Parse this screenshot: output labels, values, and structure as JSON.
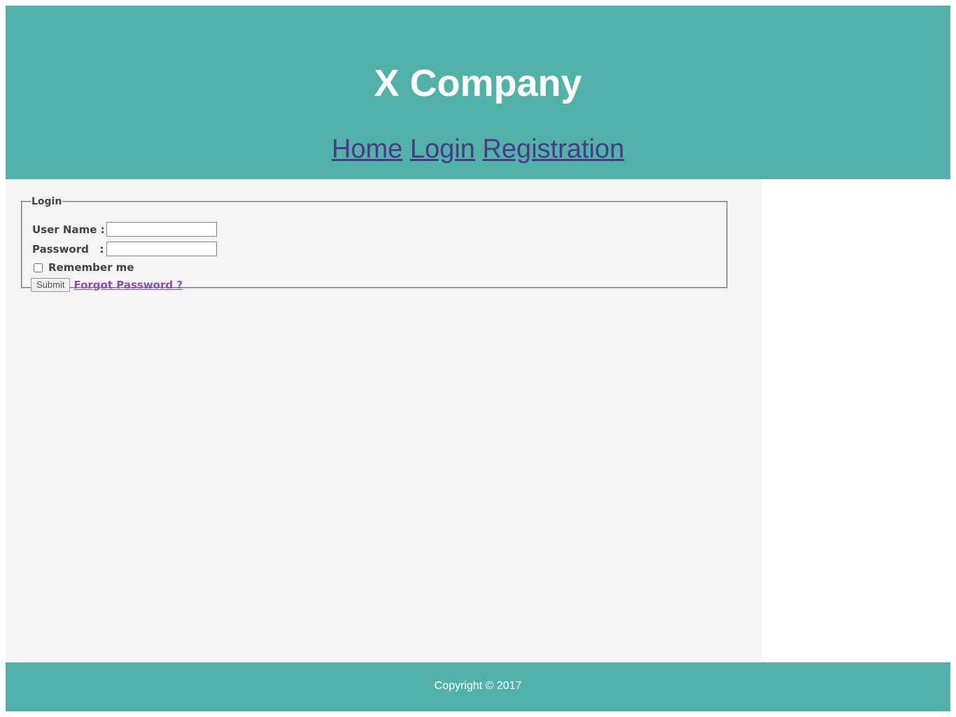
{
  "header": {
    "title": "X Company",
    "nav": [
      {
        "label": "Home"
      },
      {
        "label": "Login"
      },
      {
        "label": "Registration"
      }
    ]
  },
  "login_form": {
    "legend": "Login",
    "username_label": "User Name :",
    "username_value": "",
    "password_label": "Password   :",
    "password_value": "",
    "remember_label": "Remember me",
    "remember_checked": false,
    "submit_label": "Submit",
    "forgot_label": "Forgot Password ?"
  },
  "footer": {
    "copyright": "Copyright © 2017"
  },
  "colors": {
    "header_bg": "#52b1a8",
    "nav_link": "#4b3a8a",
    "main_bg": "#f4f4f4",
    "forgot_link": "#8a4fb0"
  }
}
